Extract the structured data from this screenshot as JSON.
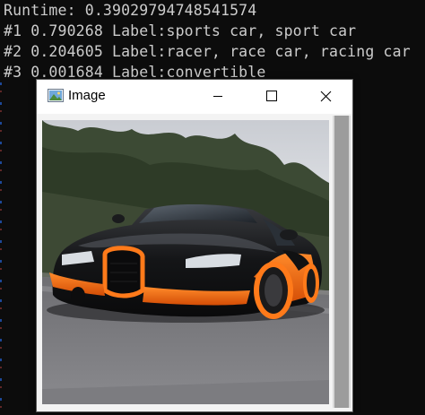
{
  "console": {
    "lines": [
      "Runtime: 0.39029794748541574",
      "#1 0.790268 Label:sports car, sport car",
      "#2 0.204605 Label:racer, race car, racing car",
      "#3 0.001684 Label:convertible"
    ]
  },
  "window": {
    "title": "Image",
    "icon": "image-app-icon",
    "buttons": {
      "minimize": "minimize-icon",
      "maximize": "maximize-icon",
      "close": "close-icon"
    }
  },
  "photo": {
    "subject": "black and orange sports car on road"
  },
  "colors": {
    "console_bg": "#0c0c0c",
    "console_text": "#cccccc",
    "window_bg": "#ffffff",
    "car_accent": "#f26a12"
  }
}
